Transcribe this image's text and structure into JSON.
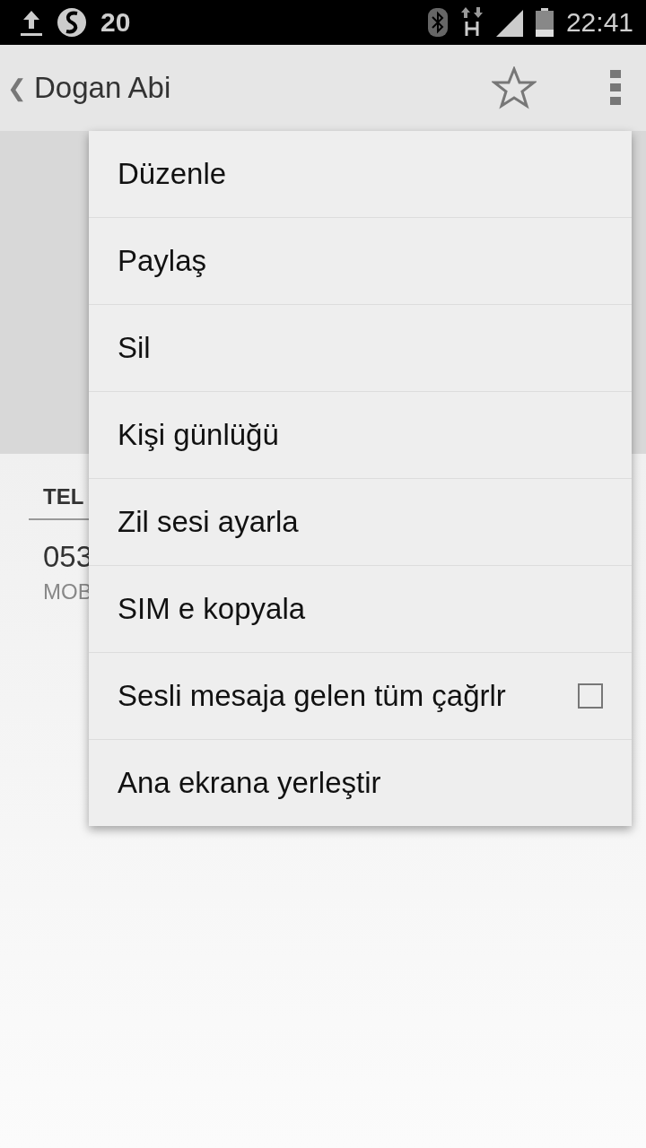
{
  "status_bar": {
    "notification_count": "20",
    "time": "22:41"
  },
  "action_bar": {
    "back": "❮",
    "title": "Dogan Abi",
    "starred": false
  },
  "contact": {
    "section_header": "TEL",
    "phone": "053",
    "phone_type": "MOB"
  },
  "menu": {
    "items": [
      {
        "label": "Düzenle",
        "kind": "plain"
      },
      {
        "label": "Paylaş",
        "kind": "plain"
      },
      {
        "label": "Sil",
        "kind": "plain"
      },
      {
        "label": "Kişi günlüğü",
        "kind": "plain"
      },
      {
        "label": "Zil sesi ayarla",
        "kind": "plain"
      },
      {
        "label": "SIM e kopyala",
        "kind": "plain"
      },
      {
        "label": "Sesli mesaja gelen tüm çağrlr",
        "kind": "checkbox",
        "checked": false
      },
      {
        "label": "Ana ekrana yerleştir",
        "kind": "plain"
      }
    ]
  }
}
